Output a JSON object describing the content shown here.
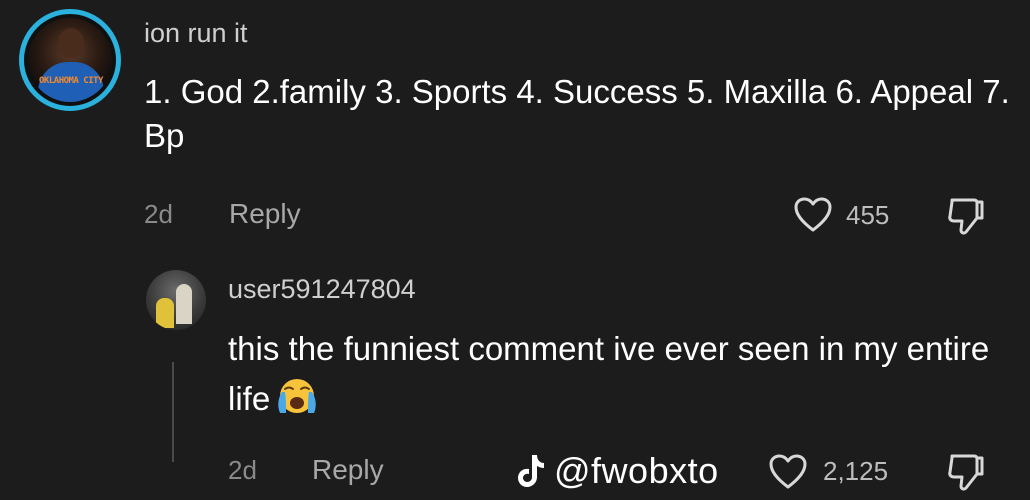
{
  "comment": {
    "username": "ion run it",
    "avatar_text": "OKLAHOMA CITY",
    "text": "1. God 2.family 3. Sports 4. Success 5. Maxilla 6. Appeal 7. Bp",
    "time": "2d",
    "reply_label": "Reply",
    "likes": "455",
    "icons": {
      "like": "heart-outline-icon",
      "dislike": "thumbs-down-outline-icon"
    },
    "accent_ring_color": "#2ab1dd"
  },
  "reply": {
    "username": "user591247804",
    "text": "this the funniest comment ive ever seen in my entire life",
    "emoji": "loudly-crying-face-emoji",
    "time": "2d",
    "reply_label": "Reply",
    "likes": "2,125",
    "icons": {
      "like": "heart-outline-icon",
      "dislike": "thumbs-down-outline-icon"
    }
  },
  "watermark": {
    "handle": "@fwobxto",
    "logo": "tiktok-logo-icon"
  },
  "colors": {
    "background": "#1c1c1c",
    "primary_text": "#ffffff",
    "secondary_text": "#8a8a8a"
  }
}
